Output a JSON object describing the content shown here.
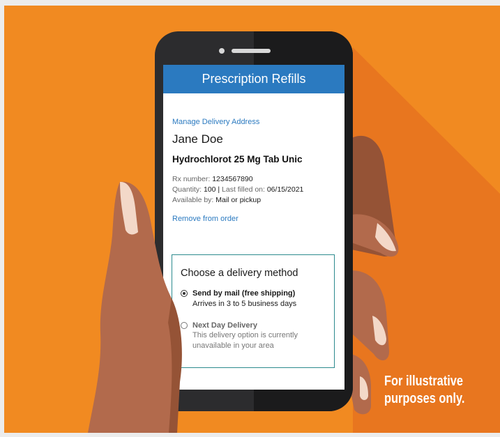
{
  "app": {
    "title": "Prescription Refills"
  },
  "order": {
    "manage_address_link": "Manage Delivery Address",
    "patient_name": "Jane Doe",
    "drug_name": "Hydrochlorot 25 Mg Tab Unic",
    "rx_number_label": "Rx number: ",
    "rx_number": "1234567890",
    "quantity_label": "Quantity: ",
    "quantity": "100",
    "separator": " | ",
    "last_filled_label": "Last filled on: ",
    "last_filled": "06/15/2021",
    "available_label": "Available by: ",
    "available": "Mail or pickup",
    "remove_link": "Remove from order"
  },
  "delivery": {
    "title": "Choose a delivery method",
    "options": [
      {
        "label": "Send by mail (free shipping)",
        "sub": "Arrives in 3 to 5 business days",
        "selected": true
      },
      {
        "label": "Next Day Delivery",
        "sub": "This delivery option is currently unavailable in your area",
        "selected": false
      }
    ]
  },
  "disclaimer": {
    "line1": "For illustrative",
    "line2": "purposes only."
  },
  "colors": {
    "background": "#f18a21",
    "shadow": "#e8761f",
    "header": "#2b7ac0",
    "link": "#2b7ac0",
    "box_border": "#2c8a8e",
    "skin": "#b26a4c",
    "skin_dark": "#955336",
    "nail": "#f3d8c8"
  }
}
